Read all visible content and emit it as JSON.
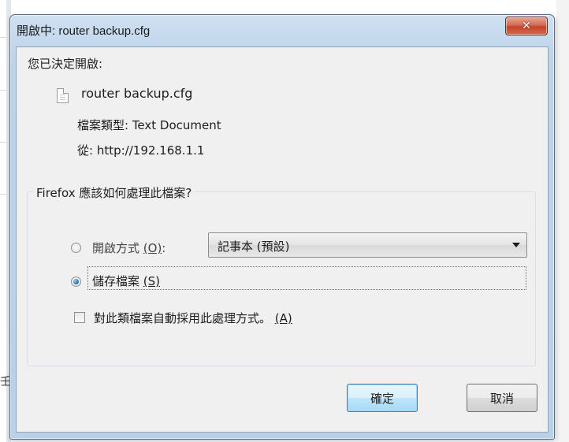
{
  "window": {
    "title": "開啟中: router backup.cfg",
    "close_label": "✕"
  },
  "dialog": {
    "heading": "您已決定開啟:",
    "file_name": "router backup.cfg",
    "file_type": "檔案類型: Text Document",
    "source": "從: http://192.168.1.1"
  },
  "action_group": {
    "legend": "Firefox 應該如何處理此檔案?",
    "open_with": {
      "label": "開啟方式 ",
      "mnemonic": "(O)",
      "suffix": ":",
      "selected": false,
      "app_value": "記事本 (預設)"
    },
    "save_file": {
      "label": "儲存檔案 ",
      "mnemonic": "(S)",
      "selected": true
    },
    "auto_apply": {
      "label": "對此類檔案自動採用此處理方式。 ",
      "mnemonic": "(A)",
      "checked": false
    }
  },
  "buttons": {
    "ok": "確定",
    "cancel": "取消"
  },
  "background": {
    "partial_glyph": "壬"
  }
}
